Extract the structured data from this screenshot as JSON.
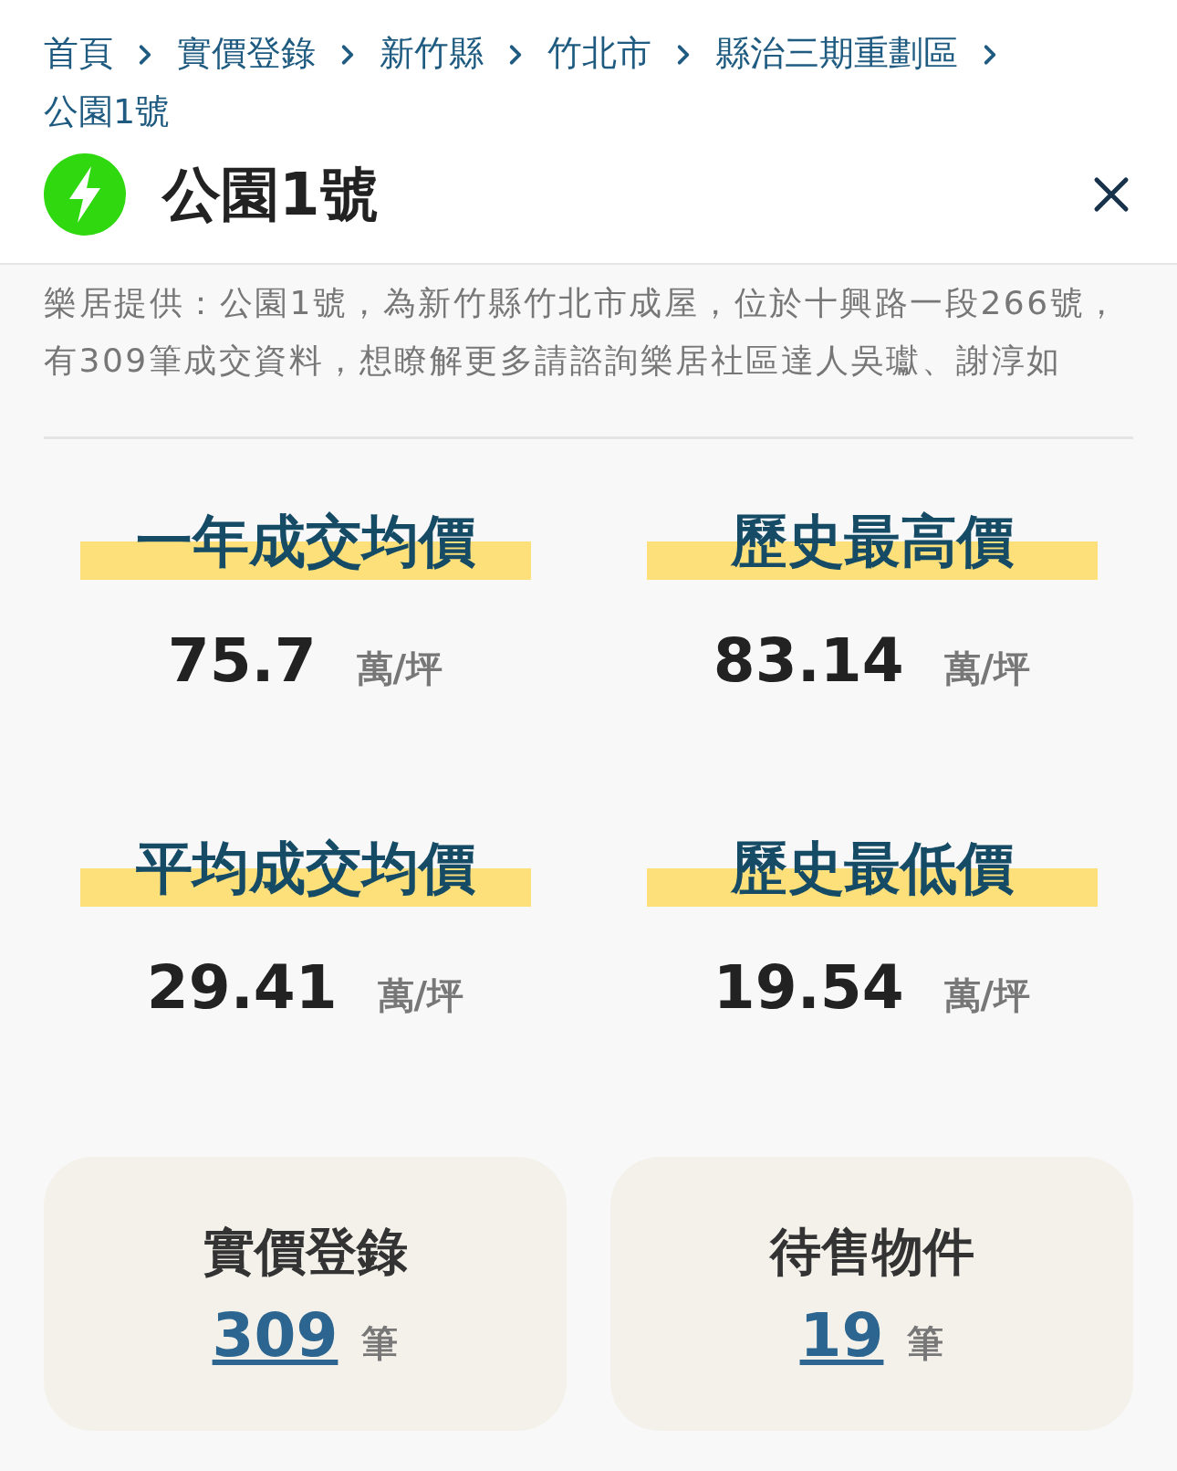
{
  "breadcrumb": [
    {
      "label": "首頁"
    },
    {
      "label": "實價登錄"
    },
    {
      "label": "新竹縣"
    },
    {
      "label": "竹北市"
    },
    {
      "label": "縣治三期重劃區"
    },
    {
      "label": "公園1號"
    }
  ],
  "header": {
    "title": "公園1號"
  },
  "description": "樂居提供：公園1號，為新竹縣竹北市成屋，位於十興路一段266號，有309筆成交資料，想瞭解更多請諮詢樂居社區達人吳瓛、謝淳如",
  "stats": [
    {
      "label": "一年成交均價",
      "value": "75.7",
      "unit": "萬/坪"
    },
    {
      "label": "歷史最高價",
      "value": "83.14",
      "unit": "萬/坪"
    },
    {
      "label": "平均成交均價",
      "value": "29.41",
      "unit": "萬/坪"
    },
    {
      "label": "歷史最低價",
      "value": "19.54",
      "unit": "萬/坪"
    }
  ],
  "summary_cards": [
    {
      "label": "實價登錄",
      "count": "309",
      "unit": "筆"
    },
    {
      "label": "待售物件",
      "count": "19",
      "unit": "筆"
    }
  ]
}
